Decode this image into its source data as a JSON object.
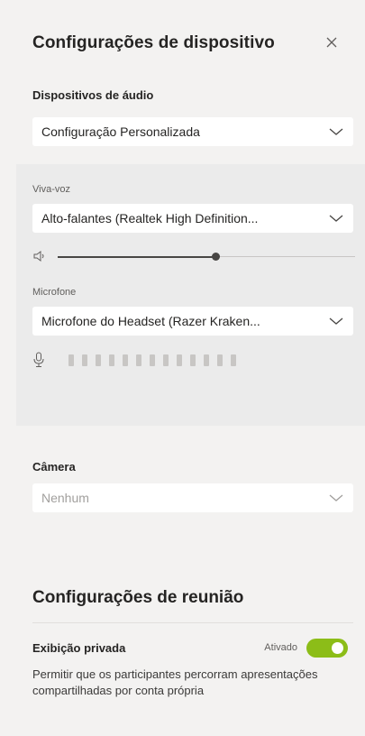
{
  "header": {
    "title": "Configurações de dispositivo"
  },
  "audio": {
    "label": "Dispositivos de áudio",
    "selected": "Configuração Personalizada"
  },
  "speaker": {
    "label": "Viva-voz",
    "selected": "Alto-falantes (Realtek High Definition...",
    "volume_percent": 53
  },
  "microphone": {
    "label": "Microfone",
    "selected": "Microfone do Headset (Razer Kraken...",
    "level_bar_count": 13
  },
  "camera": {
    "label": "Câmera",
    "selected": "Nenhum"
  },
  "meeting": {
    "title": "Configurações de reunião",
    "private_view_label": "Exibição privada",
    "private_view_state": "Ativado",
    "private_view_on": true,
    "private_view_description": "Permitir que os participantes percorram apresentações compartilhadas por conta própria"
  },
  "colors": {
    "toggle_on": "#8cbd18",
    "panel_bg": "#f3f2f1",
    "section_bg": "#ebebeb"
  },
  "icons": [
    "close-icon",
    "chevron-down-icon",
    "speaker-icon",
    "microphone-icon"
  ]
}
